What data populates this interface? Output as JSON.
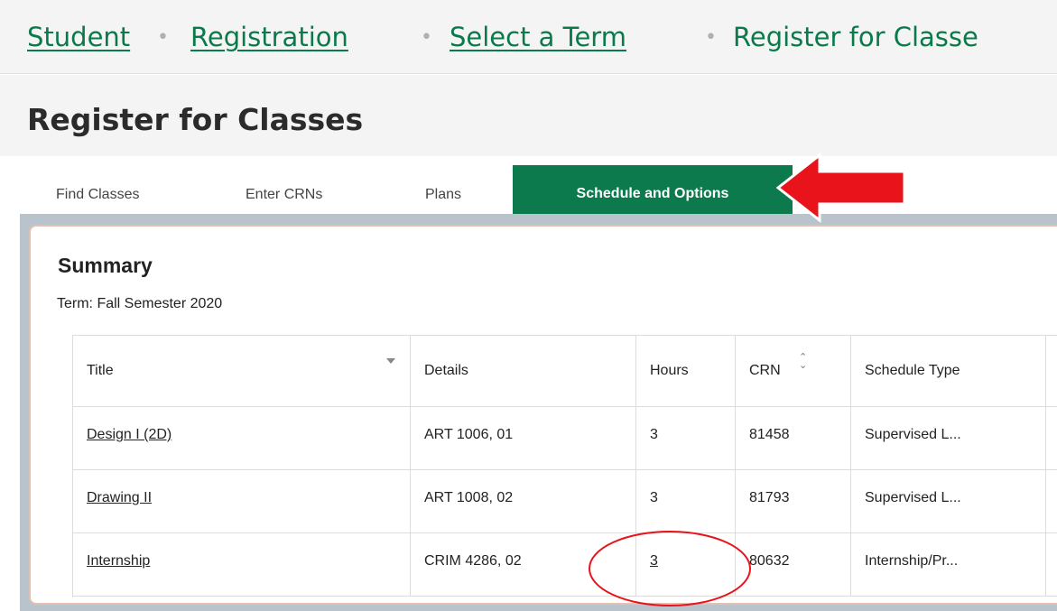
{
  "breadcrumb": {
    "items": [
      "Student",
      "Registration",
      "Select a Term",
      "Register for Classe"
    ],
    "separator": "•"
  },
  "page": {
    "title": "Register for Classes"
  },
  "tabs": {
    "items": [
      {
        "label": "Find Classes",
        "active": false
      },
      {
        "label": "Enter CRNs",
        "active": false
      },
      {
        "label": "Plans",
        "active": false
      },
      {
        "label": "Schedule and Options",
        "active": true
      }
    ]
  },
  "summary": {
    "title": "Summary",
    "term": "Term:  Fall Semester 2020"
  },
  "table": {
    "columns": [
      "Title",
      "Details",
      "Hours",
      "CRN",
      "Schedule Type"
    ],
    "rows": [
      {
        "title": "Design I (2D)",
        "details": "ART 1006, 01",
        "hours": "3",
        "crn": "81458",
        "schedule_type": "Supervised L..."
      },
      {
        "title": "Drawing II",
        "details": "ART 1008, 02",
        "hours": "3",
        "crn": "81793",
        "schedule_type": "Supervised L..."
      },
      {
        "title": "Internship",
        "details": "CRIM 4286, 02",
        "hours": "3",
        "crn": "80632",
        "schedule_type": "Internship/Pr..."
      }
    ]
  },
  "icons": {
    "sort_desc": "caret-down-icon",
    "sort_both": "sort-updown-icon"
  },
  "colors": {
    "brand_green": "#0d7a4d",
    "link_green": "#0b7a4b",
    "annotation_red": "#e8131b"
  }
}
